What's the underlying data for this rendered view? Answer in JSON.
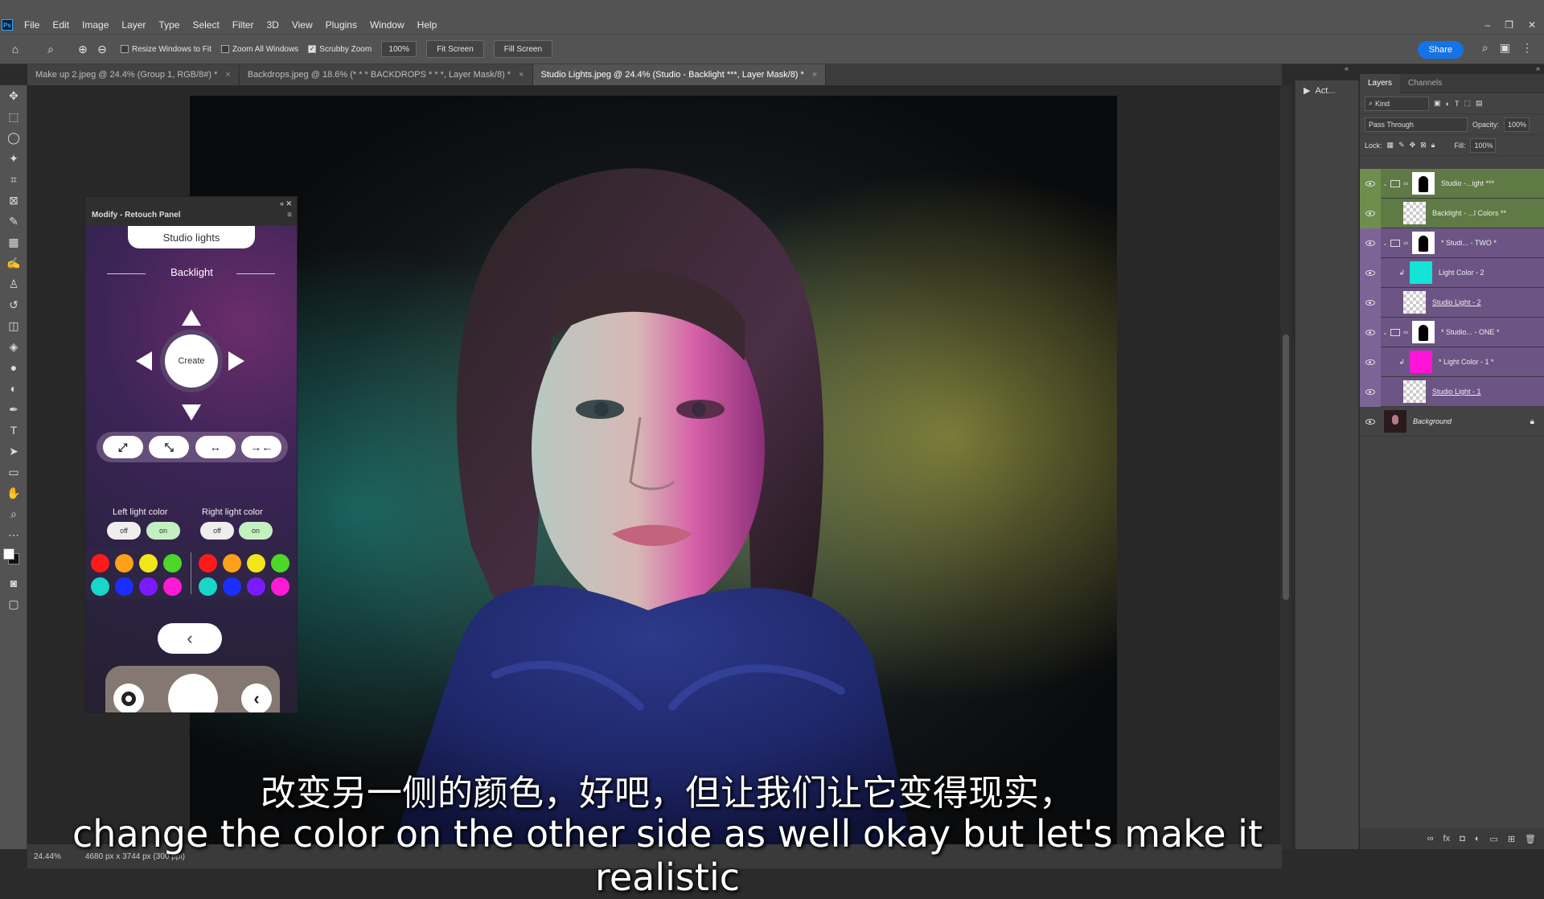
{
  "app": {
    "logo": "Ps"
  },
  "menu": [
    "File",
    "Edit",
    "Image",
    "Layer",
    "Type",
    "Select",
    "Filter",
    "3D",
    "View",
    "Plugins",
    "Window",
    "Help"
  ],
  "window_controls": {
    "minimize": "–",
    "restore": "❐",
    "close": "✕"
  },
  "options_bar": {
    "resize_windows_label": "Resize Windows to Fit",
    "zoom_all_label": "Zoom All Windows",
    "scrubby_zoom_label": "Scrubby Zoom",
    "zoom_value": "100%",
    "fit_screen": "Fit Screen",
    "fill_screen": "Fill Screen",
    "share": "Share"
  },
  "tabs": [
    {
      "label": "Make up 2.jpeg @ 24.4% (Group 1, RGB/8#) *",
      "close": "×"
    },
    {
      "label": "Backdrops.jpeg @ 18.6% (* * * BACKDROPS * * *, Layer Mask/8) *",
      "close": "×"
    },
    {
      "label": "Studio Lights.jpeg @ 24.4% (Studio - Backlight ***, Layer Mask/8) *",
      "close": "×"
    }
  ],
  "status": {
    "zoom": "24.44%",
    "doc_size": "4680 px x 3744 px (300 ppi)"
  },
  "actions_panel": {
    "label": "Act..."
  },
  "layers_panel": {
    "tabs": [
      "Layers",
      "Channels"
    ],
    "filter_kind": "Kind",
    "blend_mode": "Pass Through",
    "opacity_label": "Opacity:",
    "opacity_value": "100%",
    "lock_label": "Lock:",
    "fill_label": "Fill:",
    "fill_value": "100%",
    "layers": [
      {
        "name": "Studio -...ight ***",
        "color": "green"
      },
      {
        "name": "Backlight - ...l Colors **",
        "color": "green"
      },
      {
        "name": "* Studi... - TWO *",
        "color": "purple"
      },
      {
        "name": "Light Color - 2",
        "color": "purple"
      },
      {
        "name": "Studio Light - 2",
        "color": "purple"
      },
      {
        "name": "* Studio... - ONE *",
        "color": "purple"
      },
      {
        "name": "* Light Color - 1 *",
        "color": "purple"
      },
      {
        "name": "Studio Light - 1",
        "color": "purple"
      },
      {
        "name": "Background",
        "color": "none"
      }
    ],
    "thumb_colors": {
      "cyan": "#14e3d8",
      "magenta": "#ff14d8"
    }
  },
  "retouch_panel": {
    "title": "Modify - Retouch Panel",
    "header_title": "Studio lights",
    "section": "Backlight",
    "create": "Create",
    "left_light_label": "Left light color",
    "right_light_label": "Right light color",
    "off": "off",
    "on": "on",
    "colors_left": [
      "#ff1a1a",
      "#ffa01a",
      "#f0e61a",
      "#4fd62a",
      "#18d6c8",
      "#1a2eff",
      "#7a1aff",
      "#ff1ad6"
    ],
    "colors_right": [
      "#ff1a1a",
      "#ffa01a",
      "#f0e61a",
      "#4fd62a",
      "#18d6c8",
      "#1a2eff",
      "#7a1aff",
      "#ff1ad6"
    ],
    "back_label": "‹"
  },
  "subtitles": {
    "cn": "改变另一侧的颜色，好吧，但让我们让它变得现实，",
    "en": "change the color on the other side as well okay but let's make it realistic"
  }
}
